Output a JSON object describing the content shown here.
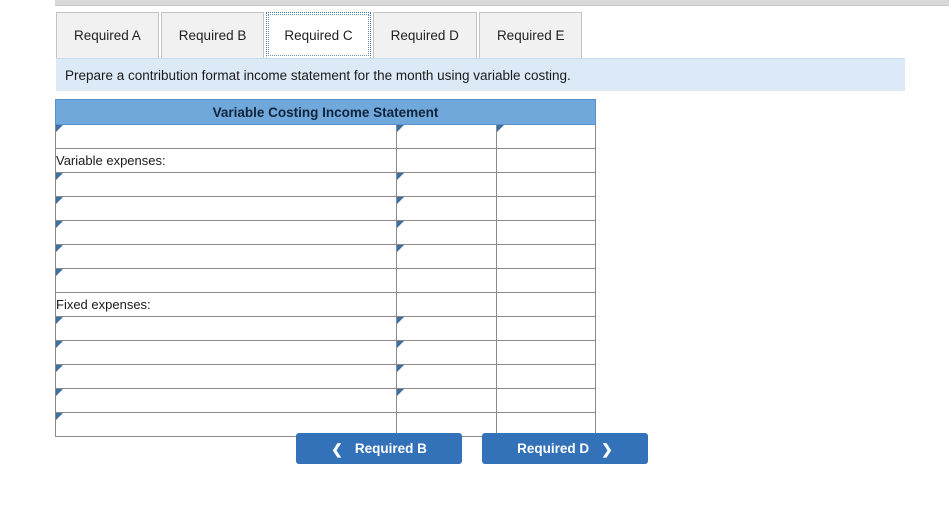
{
  "tabs": [
    {
      "label": "Required A",
      "active": false
    },
    {
      "label": "Required B",
      "active": false
    },
    {
      "label": "Required C",
      "active": true
    },
    {
      "label": "Required D",
      "active": false
    },
    {
      "label": "Required E",
      "active": false
    }
  ],
  "instruction": {
    "text": "Prepare a contribution format income statement for the month using variable costing."
  },
  "statement": {
    "title": "Variable Costing Income Statement",
    "rows": [
      {
        "type": "input",
        "label": "",
        "col2": "input",
        "col3": "input"
      },
      {
        "type": "label",
        "label": "Variable expenses:",
        "col2": "plain",
        "col3": "plain"
      },
      {
        "type": "input",
        "label": "",
        "col2": "input",
        "col3": "plain"
      },
      {
        "type": "input",
        "label": "",
        "col2": "input",
        "col3": "plain"
      },
      {
        "type": "input",
        "label": "",
        "col2": "input",
        "col3": "plain"
      },
      {
        "type": "input",
        "label": "",
        "col2": "input-subtotal",
        "col3": "plain"
      },
      {
        "type": "input",
        "label": "",
        "col2": "plain",
        "col3": "plain"
      },
      {
        "type": "label",
        "label": "Fixed expenses:",
        "col2": "plain",
        "col3": "plain"
      },
      {
        "type": "input",
        "label": "",
        "col2": "input",
        "col3": "plain"
      },
      {
        "type": "input",
        "label": "",
        "col2": "input",
        "col3": "plain"
      },
      {
        "type": "input",
        "label": "",
        "col2": "input",
        "col3": "plain"
      },
      {
        "type": "input",
        "label": "",
        "col2": "input-subtotal",
        "col3": "plain"
      },
      {
        "type": "input",
        "label": "",
        "col2": "plain",
        "col3": "grandtotal"
      }
    ]
  },
  "nav": {
    "prev_label": "Required B",
    "next_label": "Required D",
    "prev_icon": "chevron-left-icon",
    "next_icon": "chevron-right-icon"
  },
  "colors": {
    "table_header_blue": "#70a8dc",
    "instruction_banner_blue": "#dceaf7",
    "button_blue": "#3372b8",
    "input_border_blue": "#5b8ab8"
  }
}
